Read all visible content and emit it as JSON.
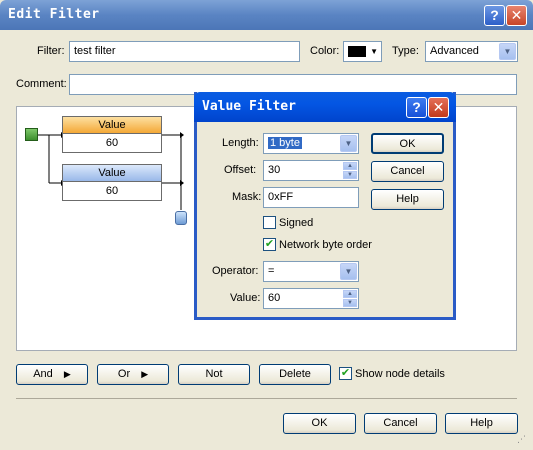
{
  "window": {
    "title": "Edit Filter"
  },
  "form": {
    "filter_label": "Filter:",
    "filter_value": "test filter",
    "color_label": "Color:",
    "type_label": "Type:",
    "type_value": "Advanced",
    "comment_label": "Comment:",
    "comment_value": ""
  },
  "canvas": {
    "nodes": [
      {
        "header": "Value",
        "value": "60",
        "color": "#f4a836"
      },
      {
        "header": "Value",
        "value": "60",
        "color": "#99b8e9"
      }
    ]
  },
  "dialog": {
    "title": "Value Filter",
    "length_label": "Length:",
    "length_value": "1 byte",
    "offset_label": "Offset:",
    "offset_value": "30",
    "mask_label": "Mask:",
    "mask_value": "0xFF",
    "signed_label": "Signed",
    "signed_checked": false,
    "nbo_label": "Network byte order",
    "nbo_checked": true,
    "operator_label": "Operator:",
    "operator_value": "=",
    "value_label": "Value:",
    "value_value": "60",
    "ok": "OK",
    "cancel": "Cancel",
    "help": "Help"
  },
  "toolbar": {
    "and": "And",
    "or": "Or",
    "not": "Not",
    "delete": "Delete",
    "show_details": "Show node details",
    "show_details_checked": true
  },
  "footer": {
    "ok": "OK",
    "cancel": "Cancel",
    "help": "Help"
  }
}
